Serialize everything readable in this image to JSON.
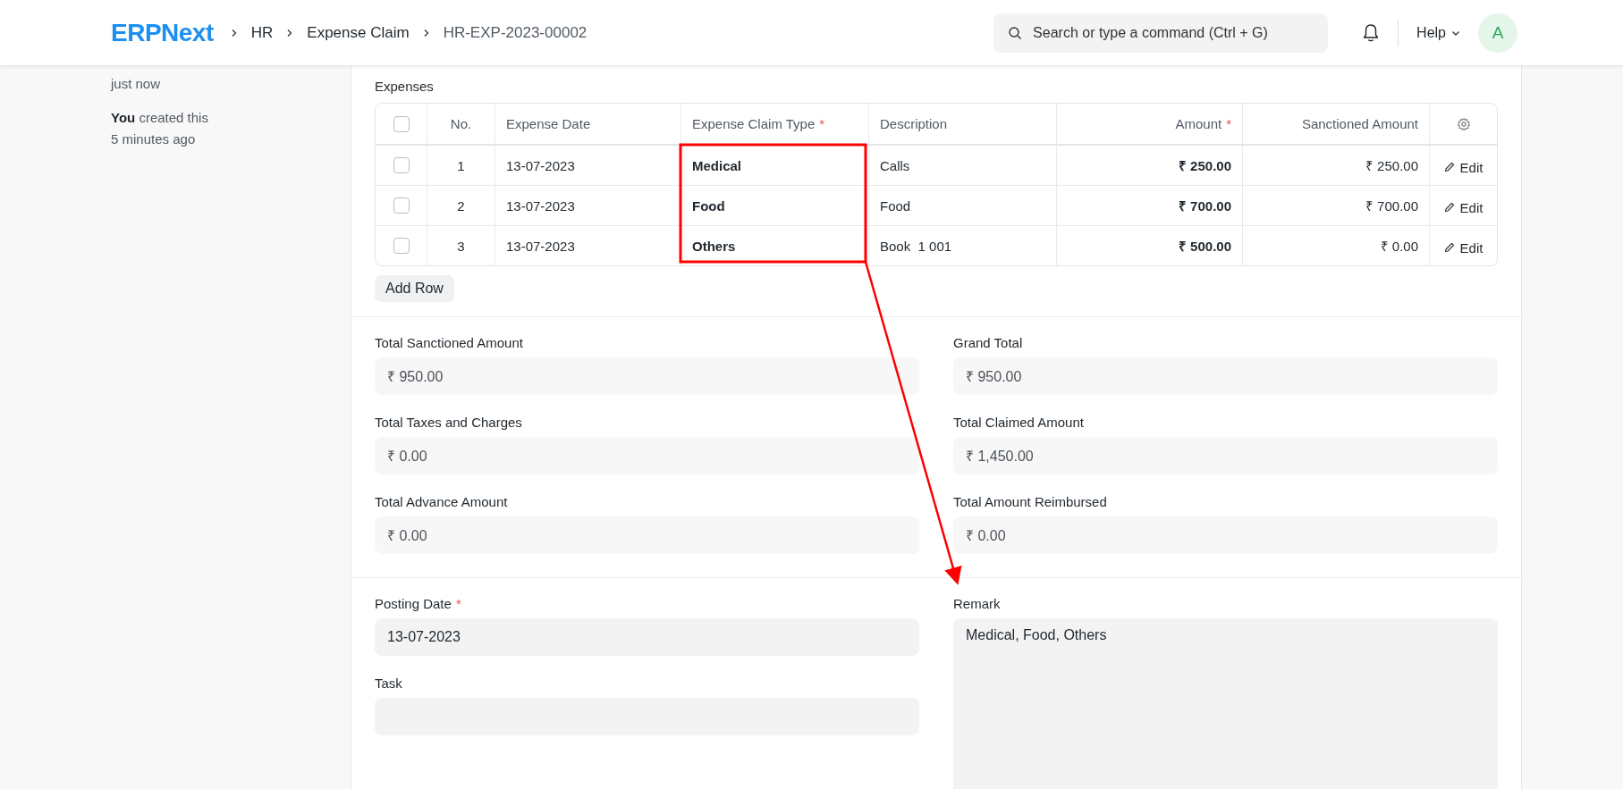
{
  "navbar": {
    "logo": "ERPNext",
    "breadcrumbs": [
      {
        "label": "HR",
        "current": false
      },
      {
        "label": "Expense Claim",
        "current": false
      },
      {
        "label": "HR-EXP-2023-00002",
        "current": true
      }
    ],
    "search": {
      "placeholder": "Search or type a command (Ctrl + G)"
    },
    "help": "Help",
    "avatar": "A"
  },
  "timeline": [
    {
      "time": "just now"
    },
    {
      "text": "**You** created this",
      "time": "5 minutes ago"
    }
  ],
  "expenses": {
    "label": "Expenses",
    "header_checked": false,
    "columns": [
      {
        "label": "No."
      },
      {
        "label": "Expense Date"
      },
      {
        "label": "Expense Claim Type",
        "required_mark": "*"
      },
      {
        "label": "Description"
      },
      {
        "label": "Amount",
        "required_mark": "*"
      },
      {
        "label": "Sanctioned Amount"
      }
    ],
    "rows": [
      {
        "checked": false,
        "no": "1",
        "date": "13-07-2023",
        "type": "Medical",
        "description": "Calls",
        "amount": "₹ 250.00",
        "sanctioned": "₹ 250.00",
        "action": "Edit"
      },
      {
        "checked": false,
        "no": "2",
        "date": "13-07-2023",
        "type": "Food",
        "description": "Food",
        "amount": "₹ 700.00",
        "sanctioned": "₹ 700.00",
        "action": "Edit"
      },
      {
        "checked": false,
        "no": "3",
        "date": "13-07-2023",
        "type": "Others",
        "description": "Book  1 001",
        "amount": "₹ 500.00",
        "sanctioned": "₹ 0.00",
        "action": "Edit"
      }
    ],
    "add_row": "Add Row"
  },
  "sections": [
    {
      "left": [
        {
          "kind": "input",
          "label": "Total Sanctioned Amount",
          "read_only": true,
          "value": "₹ 950.00"
        },
        {
          "kind": "input",
          "label": "Total Taxes and Charges",
          "read_only": true,
          "value": "₹ 0.00"
        },
        {
          "kind": "input",
          "label": "Total Advance Amount",
          "read_only": true,
          "value": "₹ 0.00"
        }
      ],
      "right": [
        {
          "kind": "input",
          "label": "Grand Total",
          "read_only": true,
          "value": "₹ 950.00"
        },
        {
          "kind": "input",
          "label": "Total Claimed Amount",
          "read_only": true,
          "value": "₹ 1,450.00"
        },
        {
          "kind": "input",
          "label": "Total Amount Reimbursed",
          "read_only": true,
          "value": "₹ 0.00"
        }
      ]
    },
    {
      "left": [
        {
          "kind": "input",
          "label": "Posting Date",
          "required_mark": "*",
          "read_only": false,
          "value": "13-07-2023"
        },
        {
          "kind": "input",
          "label": "Task"
        }
      ],
      "right": [
        {
          "kind": "textarea",
          "label": "Remark",
          "value": "Medical, Food, Others"
        }
      ]
    }
  ],
  "annotation": {
    "kind": "box-arrow"
  }
}
